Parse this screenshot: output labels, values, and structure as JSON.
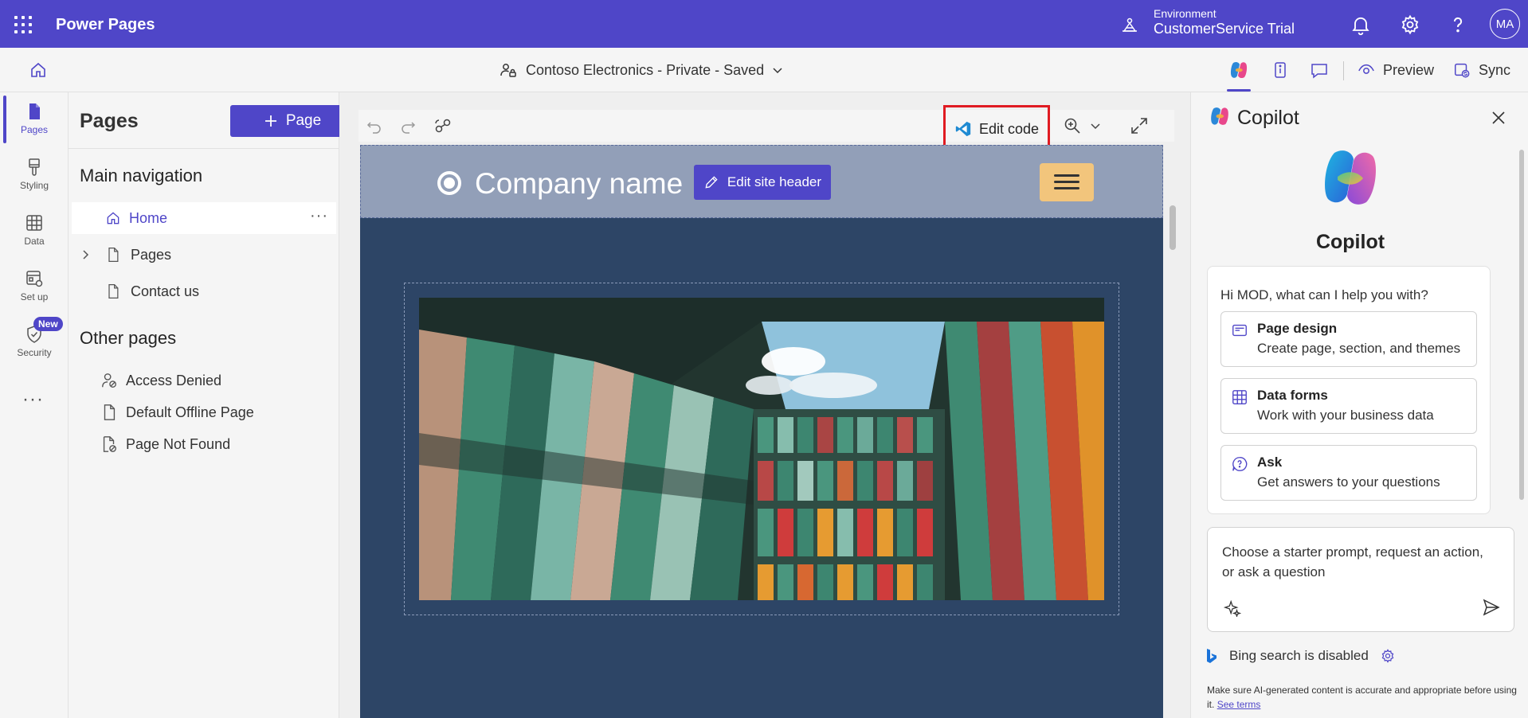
{
  "suite": {
    "app_title": "Power Pages",
    "environment_label": "Environment",
    "environment_name": "CustomerService Trial",
    "avatar_initials": "MA"
  },
  "command_bar": {
    "site_title": "Contoso Electronics - Private - Saved",
    "preview_label": "Preview",
    "sync_label": "Sync"
  },
  "rail": {
    "items": [
      {
        "label": "Pages",
        "icon": "page-icon"
      },
      {
        "label": "Styling",
        "icon": "paintbrush-icon"
      },
      {
        "label": "Data",
        "icon": "table-icon"
      },
      {
        "label": "Set up",
        "icon": "setup-icon"
      },
      {
        "label": "Security",
        "icon": "shield-icon"
      }
    ],
    "new_badge": "New"
  },
  "pages_panel": {
    "title": "Pages",
    "add_button_label": "Page",
    "main_nav_title": "Main navigation",
    "main_nav_items": [
      {
        "label": "Home",
        "icon": "home-icon"
      },
      {
        "label": "Pages",
        "icon": "page-icon"
      },
      {
        "label": "Contact us",
        "icon": "page-icon"
      }
    ],
    "other_pages_title": "Other pages",
    "other_pages_items": [
      {
        "label": "Access Denied",
        "icon": "person-blocked-icon"
      },
      {
        "label": "Default Offline Page",
        "icon": "page-icon"
      },
      {
        "label": "Page Not Found",
        "icon": "page-blocked-icon"
      }
    ]
  },
  "canvas": {
    "edit_code_label": "Edit code",
    "company_name": "Company name",
    "edit_header_label": "Edit site header"
  },
  "copilot": {
    "pane_title": "Copilot",
    "heading": "Copilot",
    "greeting": "Hi MOD, what can I help you with?",
    "options": [
      {
        "title": "Page design",
        "subtitle": "Create page, section, and themes",
        "icon": "page-design-icon"
      },
      {
        "title": "Data forms",
        "subtitle": "Work with your business data",
        "icon": "table-icon"
      },
      {
        "title": "Ask",
        "subtitle": "Get answers to your questions",
        "icon": "chat-question-icon"
      }
    ],
    "input_placeholder": "Choose a starter prompt, request an action, or ask a question",
    "bing_status": "Bing search is disabled",
    "disclaimer": "Make sure AI-generated content is accurate and appropriate before using it.",
    "see_terms": "See terms"
  },
  "colors": {
    "brand": "#4f46c8",
    "highlight_box": "#e01b22",
    "site_header_bg": "#929fb8",
    "site_body_bg": "#2d4566",
    "hamburger_bg": "#f2c57c"
  }
}
